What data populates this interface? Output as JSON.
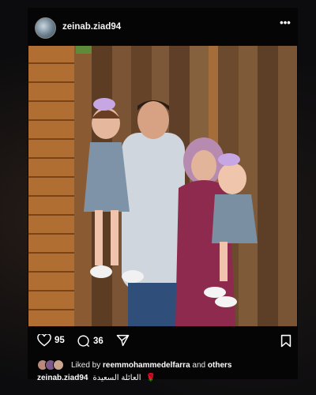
{
  "post": {
    "username": "zeinab.ziad94",
    "more_label": "•••",
    "image_alt": "Family photo in front of a wooden log wall"
  },
  "actions": {
    "like_count": "95",
    "comment_count": "36"
  },
  "liked_by": {
    "prefix": "Liked by",
    "user": "reemmohammedelfarra",
    "connector": "and",
    "suffix": "others"
  },
  "caption": {
    "username": "zeinab.ziad94",
    "text": "العائلة السعيدة",
    "emoji": "🌹"
  },
  "colors": {
    "background": "#0b0b0c",
    "card": "#050505",
    "text": "#f2f2f2",
    "rose": "#e0213a"
  },
  "icons": [
    "heart-icon",
    "comment-icon",
    "share-icon",
    "bookmark-icon",
    "more-icon"
  ]
}
